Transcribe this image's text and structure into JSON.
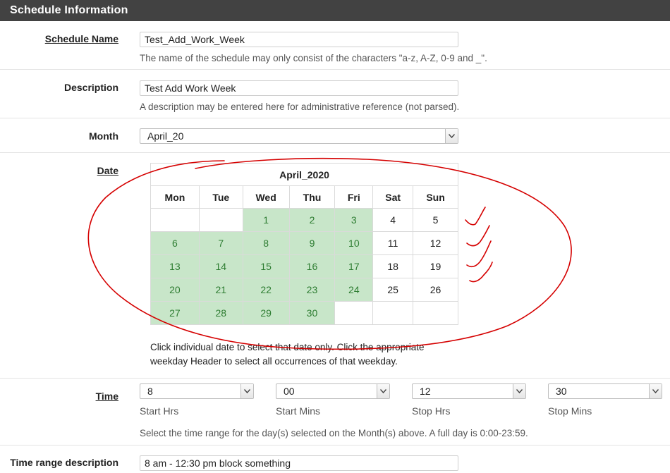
{
  "panel": {
    "title": "Schedule Information"
  },
  "schedule_name": {
    "label": "Schedule Name",
    "value": "Test_Add_Work_Week",
    "help": "The name of the schedule may only consist of the characters \"a-z, A-Z, 0-9 and _\"."
  },
  "description": {
    "label": "Description",
    "value": "Test Add Work Week",
    "help": "A description may be entered here for administrative reference (not parsed)."
  },
  "month": {
    "label": "Month",
    "value": "April_20"
  },
  "date": {
    "label": "Date",
    "calendar_title": "April_2020",
    "weekdays": [
      "Mon",
      "Tue",
      "Wed",
      "Thu",
      "Fri",
      "Sat",
      "Sun"
    ],
    "weeks": [
      [
        {
          "d": ""
        },
        {
          "d": ""
        },
        {
          "d": "1",
          "sel": true
        },
        {
          "d": "2",
          "sel": true
        },
        {
          "d": "3",
          "sel": true
        },
        {
          "d": "4"
        },
        {
          "d": "5"
        }
      ],
      [
        {
          "d": "6",
          "sel": true
        },
        {
          "d": "7",
          "sel": true
        },
        {
          "d": "8",
          "sel": true
        },
        {
          "d": "9",
          "sel": true
        },
        {
          "d": "10",
          "sel": true
        },
        {
          "d": "11"
        },
        {
          "d": "12"
        }
      ],
      [
        {
          "d": "13",
          "sel": true
        },
        {
          "d": "14",
          "sel": true
        },
        {
          "d": "15",
          "sel": true
        },
        {
          "d": "16",
          "sel": true
        },
        {
          "d": "17",
          "sel": true
        },
        {
          "d": "18"
        },
        {
          "d": "19"
        }
      ],
      [
        {
          "d": "20",
          "sel": true
        },
        {
          "d": "21",
          "sel": true
        },
        {
          "d": "22",
          "sel": true
        },
        {
          "d": "23",
          "sel": true
        },
        {
          "d": "24",
          "sel": true
        },
        {
          "d": "25"
        },
        {
          "d": "26"
        }
      ],
      [
        {
          "d": "27",
          "sel": true
        },
        {
          "d": "28",
          "sel": true
        },
        {
          "d": "29",
          "sel": true
        },
        {
          "d": "30",
          "sel": true
        },
        {
          "d": ""
        },
        {
          "d": ""
        },
        {
          "d": ""
        }
      ]
    ],
    "help_line1": "Click individual date to select that date only. Click the appropriate",
    "help_line2": "weekday Header to select all occurrences of that weekday."
  },
  "time": {
    "label": "Time",
    "start_hrs": {
      "value": "8",
      "caption": "Start Hrs"
    },
    "start_mins": {
      "value": "00",
      "caption": "Start Mins"
    },
    "stop_hrs": {
      "value": "12",
      "caption": "Stop Hrs"
    },
    "stop_mins": {
      "value": "30",
      "caption": "Stop Mins"
    },
    "help": "Select the time range for the day(s) selected on the Month(s) above. A full day is 0:00-23:59."
  },
  "time_range_description": {
    "label": "Time range description",
    "value": "8 am - 12:30 pm block something"
  },
  "colors": {
    "header_bg": "#424242",
    "selected_day_bg": "#c8e6c9",
    "selected_day_text": "#2e7d32",
    "annotation": "#d50000"
  },
  "icons": {
    "select_arrow": "chevron-down-icon"
  }
}
